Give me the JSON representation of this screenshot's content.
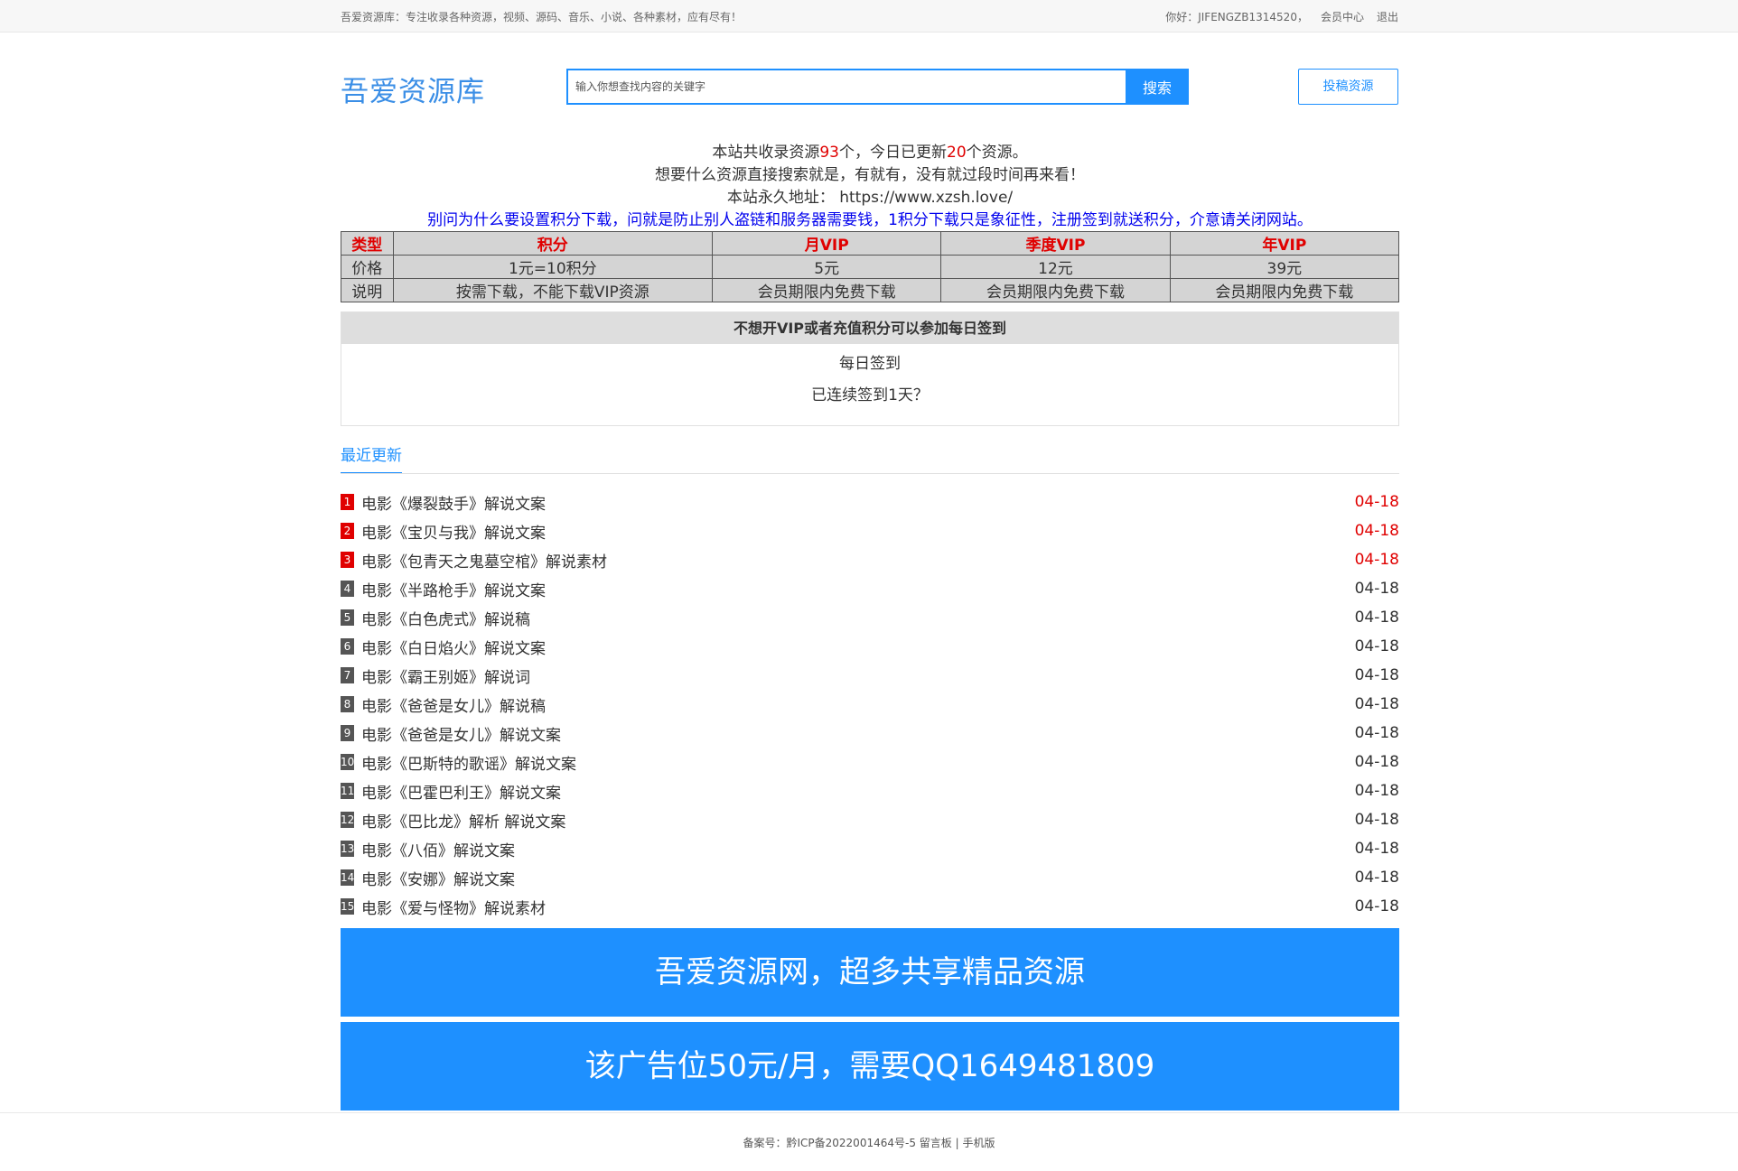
{
  "topbar": {
    "tagline": "吾爱资源库：专注收录各种资源，视频、源码、音乐、小说、各种素材，应有尽有！",
    "greeting": "你好：JIFENGZB1314520，",
    "member_center": "会员中心",
    "logout": "退出"
  },
  "header": {
    "logo": "吾爱资源库",
    "search_placeholder": "输入你想查找内容的关键字",
    "search_button": "搜索",
    "submit_button": "投稿资源"
  },
  "notice": {
    "line1_a": "本站共收录资源",
    "line1_total": "93",
    "line1_b": "个，今日已更新",
    "line1_today": "20",
    "line1_c": "个资源。",
    "line2": "想要什么资源直接搜索就是，有就有，没有就过段时间再来看！",
    "line3": "本站永久地址： https://www.xzsh.love/",
    "line4": "别问为什么要设置积分下载，问就是防止别人盗链和服务器需要钱，1积分下载只是象征性，注册签到就送积分，介意请关闭网站。"
  },
  "price_table": {
    "headers": [
      "类型",
      "积分",
      "月VIP",
      "季度VIP",
      "年VIP"
    ],
    "rows": [
      [
        "价格",
        "1元=10积分",
        "5元",
        "12元",
        "39元"
      ],
      [
        "说明",
        "按需下载，不能下载VIP资源",
        "会员期限内免费下载",
        "会员期限内免费下载",
        "会员期限内免费下载"
      ]
    ]
  },
  "signin": {
    "heading": "不想开VIP或者充值积分可以参加每日签到",
    "button": "每日签到",
    "streak": "已连续签到1天？"
  },
  "recent": {
    "tab": "最近更新",
    "items": [
      {
        "num": "1",
        "title": "电影《爆裂鼓手》解说文案",
        "date": "04-18",
        "hot": true
      },
      {
        "num": "2",
        "title": "电影《宝贝与我》解说文案",
        "date": "04-18",
        "hot": true
      },
      {
        "num": "3",
        "title": "电影《包青天之鬼墓空棺》解说素材",
        "date": "04-18",
        "hot": true
      },
      {
        "num": "4",
        "title": "电影《半路枪手》解说文案",
        "date": "04-18",
        "hot": false
      },
      {
        "num": "5",
        "title": "电影《白色虎式》解说稿",
        "date": "04-18",
        "hot": false
      },
      {
        "num": "6",
        "title": "电影《白日焰火》解说文案",
        "date": "04-18",
        "hot": false
      },
      {
        "num": "7",
        "title": "电影《霸王别姬》解说词",
        "date": "04-18",
        "hot": false
      },
      {
        "num": "8",
        "title": "电影《爸爸是女儿》解说稿",
        "date": "04-18",
        "hot": false
      },
      {
        "num": "9",
        "title": "电影《爸爸是女儿》解说文案",
        "date": "04-18",
        "hot": false
      },
      {
        "num": "10",
        "title": "电影《巴斯特的歌谣》解说文案",
        "date": "04-18",
        "hot": false
      },
      {
        "num": "11",
        "title": "电影《巴霍巴利王》解说文案",
        "date": "04-18",
        "hot": false
      },
      {
        "num": "12",
        "title": "电影《巴比龙》解析 解说文案",
        "date": "04-18",
        "hot": false
      },
      {
        "num": "13",
        "title": "电影《八佰》解说文案",
        "date": "04-18",
        "hot": false
      },
      {
        "num": "14",
        "title": "电影《安娜》解说文案",
        "date": "04-18",
        "hot": false
      },
      {
        "num": "15",
        "title": "电影《爱与怪物》解说素材",
        "date": "04-18",
        "hot": false
      }
    ]
  },
  "ads": {
    "ad1": "吾爱资源网，超多共享精品资源",
    "ad2": "该广告位50元/月，需要QQ1649481809"
  },
  "footer": {
    "icp_label": "备案号：",
    "icp": "黔ICP备2022001464号-5",
    "guestbook": "留言板",
    "sep": "|",
    "mobile": "手机版"
  },
  "colors": {
    "accent": "#1e90ff",
    "hot": "#e00000",
    "notice_blue": "#0000ee"
  }
}
